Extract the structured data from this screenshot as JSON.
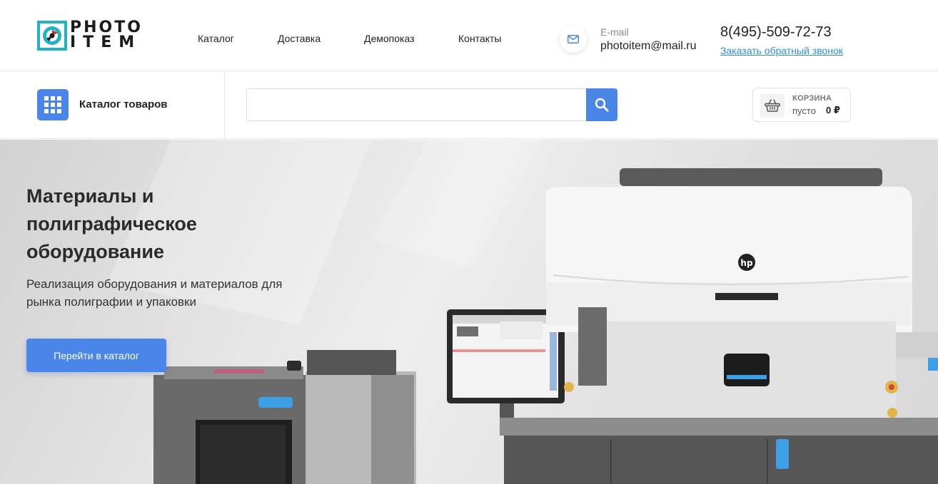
{
  "logo": {
    "line1": "PHOTO",
    "line2": "ITEM"
  },
  "nav": [
    {
      "label": "Каталог"
    },
    {
      "label": "Доставка"
    },
    {
      "label": "Демопоказ"
    },
    {
      "label": "Контакты"
    }
  ],
  "contact": {
    "email_label": "E-mail",
    "email": "photoitem@mail.ru",
    "phone": "8(495)-509-72-73",
    "callback": "Заказать обратный звонок"
  },
  "catalog": {
    "label": "Каталог товаров"
  },
  "search": {
    "placeholder": "",
    "value": ""
  },
  "cart": {
    "title": "КОРЗИНА",
    "status": "пусто",
    "sum": "0 ₽"
  },
  "hero": {
    "title": "Материалы и полиграфическое оборудование",
    "subtitle": "Реализация оборудования и материалов для рынка полиграфии и упаковки",
    "button": "Перейти в каталог",
    "machine_brand": "hp"
  },
  "colors": {
    "accent": "#4a86e8",
    "link": "#2f8fd8",
    "logo_teal": "#1fb3c3"
  },
  "icons": [
    "mail-icon",
    "grid-icon",
    "search-icon",
    "basket-icon",
    "logo-aperture-icon"
  ]
}
